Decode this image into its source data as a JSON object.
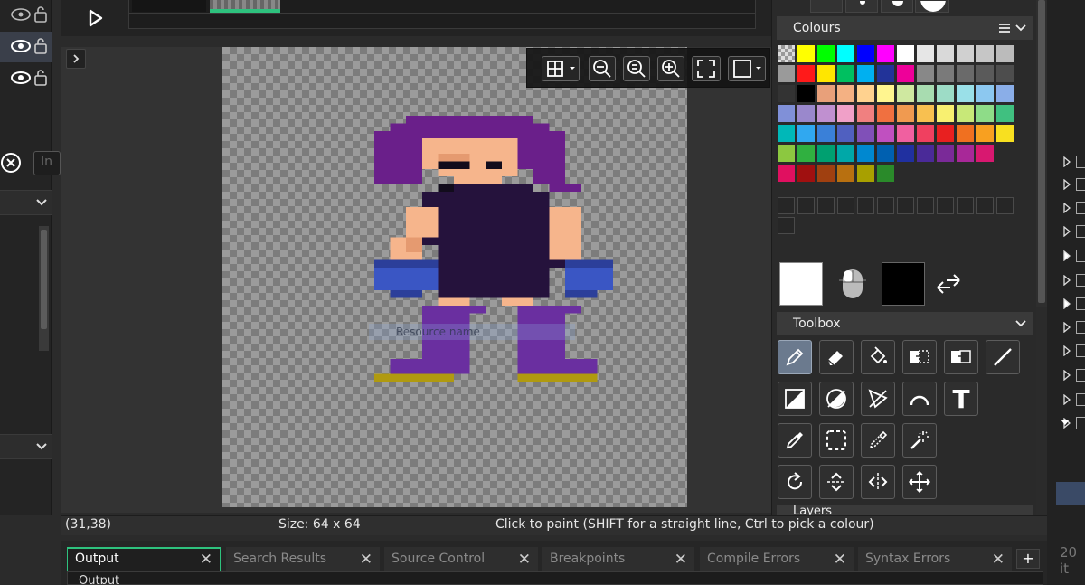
{
  "layers": [
    {
      "visibility_icon": "eye-icon",
      "lock_icon": "lock-open-icon",
      "selected": false
    },
    {
      "visibility_icon": "eye-icon",
      "lock_icon": "lock-open-icon",
      "selected": true
    },
    {
      "visibility_icon": "eye-icon",
      "lock_icon": "lock-open-icon",
      "selected": false
    }
  ],
  "left_panel": {
    "name_input_value": "In"
  },
  "canvas": {
    "room_label": "Resource name"
  },
  "status": {
    "coords": "(31,38)",
    "size": "Size: 64 x 64",
    "hint": "Click to paint (SHIFT for a straight line, Ctrl to pick a colour)"
  },
  "colours_panel": {
    "title": "Colours",
    "swatches": [
      [
        "transparent",
        "#ffff00",
        "#00ff00",
        "#00ffff",
        "#0000ff",
        "#ff00ff",
        "#ffffff",
        "#e6e6e6",
        "#d9d9d9",
        "#d0d0d0",
        "#c6c6c6",
        "#bbbbbb"
      ],
      [
        "#9a9a9a",
        "#ff1a1a",
        "#ffe600",
        "#00c060",
        "#00b0f0",
        "#223399",
        "#ee0099",
        "#888888",
        "#7a7a7a",
        "#6a6a6a",
        "#5a5a5a",
        "#4d4d4d"
      ],
      [
        "#333333",
        "#000000",
        "#e8a07a",
        "#f4b183",
        "#ffd28f",
        "#fff58f",
        "#cfe8a0",
        "#a8dcb0",
        "#9ddcc6",
        "#9ae0e8",
        "#8cc8f0",
        "#8aaee8"
      ],
      [
        "#8090d8",
        "#9a88cc",
        "#c090d0",
        "#f0a0c8",
        "#f08080",
        "#f07040",
        "#f09a50",
        "#f8c050",
        "#f8f070",
        "#c8e878",
        "#8edc88",
        "#40c080"
      ],
      [
        "#00b8b8",
        "#30a8f0",
        "#3a80d8",
        "#5060c0",
        "#8050b8",
        "#c050c0",
        "#f060a0",
        "#f04060",
        "#e82020",
        "#f07020",
        "#f8a020",
        "#f8e020"
      ],
      [
        "#8cc840",
        "#30b040",
        "#00a070",
        "#00a8a8",
        "#0088d0",
        "#0060b0",
        "#2030a0",
        "#4a2a98",
        "#7a2a98",
        "#a82898",
        "#d81870",
        "",
        ""
      ],
      [
        "#e01060",
        "#a01010",
        "#a04010",
        "#b87010",
        "#a8a000",
        "#2a8a2a",
        "",
        "",
        "",
        "",
        "",
        ""
      ]
    ]
  },
  "toolbox": {
    "title": "Toolbox",
    "tools": [
      {
        "name": "pencil-icon",
        "active": true
      },
      {
        "name": "eraser-icon",
        "active": false
      },
      {
        "name": "fill-bucket-icon",
        "active": false
      },
      {
        "name": "copy-selection-icon",
        "active": false
      },
      {
        "name": "paste-selection-icon",
        "active": false
      },
      {
        "name": "line-icon",
        "active": false
      },
      {
        "name": "rectangle-fill-icon",
        "active": false
      },
      {
        "name": "ellipse-fill-icon",
        "active": false
      },
      {
        "name": "polygon-fill-icon",
        "active": false
      },
      {
        "name": "arc-icon",
        "active": false
      },
      {
        "name": "text-icon",
        "active": false
      },
      {
        "name": "eyedropper-icon",
        "active": false
      },
      {
        "name": "rectangle-select-icon",
        "active": false
      },
      {
        "name": "colour-select-icon",
        "active": false
      },
      {
        "name": "magic-wand-icon",
        "active": false
      },
      {
        "name": "rotate-icon",
        "active": false
      },
      {
        "name": "flip-vertical-icon",
        "active": false
      },
      {
        "name": "flip-horizontal-icon",
        "active": false
      },
      {
        "name": "move-icon",
        "active": false
      }
    ],
    "text_tool_glyph": "T"
  },
  "next_panel_label": "Layers",
  "output_tabs": [
    {
      "label": "Output",
      "active": true
    },
    {
      "label": "Search Results",
      "active": false
    },
    {
      "label": "Source Control",
      "active": false
    },
    {
      "label": "Breakpoints",
      "active": false
    },
    {
      "label": "Compile Errors",
      "active": false
    },
    {
      "label": "Syntax Errors",
      "active": false
    }
  ],
  "output_sub_label": "Output",
  "far_right_number": "20 it",
  "close_glyph": "✕",
  "add_glyph": "+"
}
